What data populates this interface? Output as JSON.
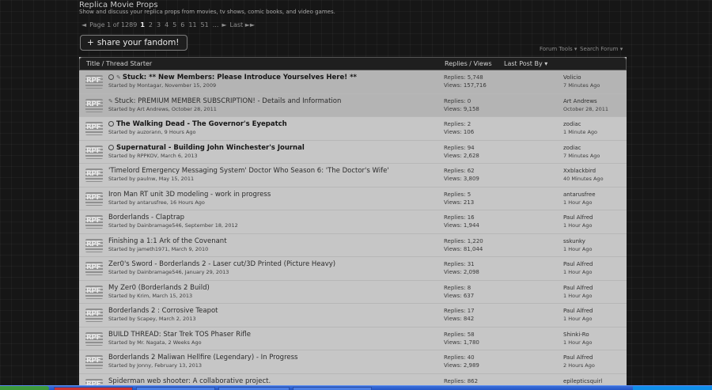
{
  "forum": {
    "title": "Replica Movie Props",
    "description": "Show and discuss your replica props from movies, tv shows, comic books, and video games."
  },
  "pagination": {
    "prev": "◄",
    "page_label": "Page 1 of 1289",
    "pages": [
      "1",
      "2",
      "3",
      "4",
      "5",
      "6",
      "11",
      "51",
      "..."
    ],
    "next": "►",
    "last": "Last ►►"
  },
  "share_button": {
    "label": "share your fandom!",
    "icon": "plus-icon"
  },
  "tools": {
    "forum_tools": "Forum Tools ▾",
    "search_forum": "Search Forum ▾"
  },
  "table": {
    "col_title": "Title / Thread Starter",
    "col_stats": "Replies / Views",
    "col_last": "Last Post By ▾",
    "rows": [
      {
        "title": "Stuck: ** New Members: Please Introduce Yourselves Here! **",
        "starter": "Started by Montagar, November 15, 2009",
        "replies": "Replies: 5,748",
        "views": "Views: 157,716",
        "last_user": "Volicio",
        "last_time": "7 Minutes Ago",
        "bold": true,
        "sticky": true,
        "circle": true,
        "pin": true
      },
      {
        "title": "Stuck: PREMIUM MEMBER SUBSCRIPTION! - Details and Information",
        "starter": "Started by Art Andrews, October 28, 2011",
        "replies": "Replies: 0",
        "views": "Views: 9,158",
        "last_user": "Art Andrews",
        "last_time": "October 28, 2011",
        "bold": false,
        "sticky": true,
        "circle": false,
        "pin": true
      },
      {
        "title": "The Walking Dead - The Governor's Eyepatch",
        "starter": "Started by auzorann, 9 Hours Ago",
        "replies": "Replies: 2",
        "views": "Views: 106",
        "last_user": "zodiac",
        "last_time": "1 Minute Ago",
        "bold": true,
        "sticky": false,
        "circle": true,
        "pin": false
      },
      {
        "title": "Supernatural - Building John Winchester's Journal",
        "starter": "Started by RPPKOV, March 6, 2013",
        "replies": "Replies: 94",
        "views": "Views: 2,628",
        "last_user": "zodiac",
        "last_time": "7 Minutes Ago",
        "bold": true,
        "sticky": false,
        "circle": true,
        "pin": false
      },
      {
        "title": "'Timelord Emergency Messaging System' Doctor Who Season 6: 'The Doctor's Wife'",
        "starter": "Started by paulnw, May 15, 2011",
        "replies": "Replies: 62",
        "views": "Views: 3,809",
        "last_user": "Xxblackbird",
        "last_time": "40 Minutes Ago",
        "bold": false,
        "sticky": false,
        "circle": false,
        "pin": false
      },
      {
        "title": "Iron Man RT unit 3D modeling - work in progress",
        "starter": "Started by antarusfree, 16 Hours Ago",
        "replies": "Replies: 5",
        "views": "Views: 213",
        "last_user": "antarusfree",
        "last_time": "1 Hour Ago",
        "bold": false,
        "sticky": false,
        "circle": false,
        "pin": false
      },
      {
        "title": "Borderlands - Claptrap",
        "starter": "Started by Dainbramage546, September 18, 2012",
        "replies": "Replies: 16",
        "views": "Views: 1,944",
        "last_user": "Paul Alfred",
        "last_time": "1 Hour Ago",
        "bold": false,
        "sticky": false,
        "circle": false,
        "pin": false
      },
      {
        "title": "Finishing a 1:1 Ark of the Covenant",
        "starter": "Started by jameth1971, March 9, 2010",
        "replies": "Replies: 1,220",
        "views": "Views: 81,044",
        "last_user": "sskunky",
        "last_time": "1 Hour Ago",
        "bold": false,
        "sticky": false,
        "circle": false,
        "pin": false
      },
      {
        "title": "Zer0's Sword - Borderlands 2 - Laser cut/3D Printed (Picture Heavy)",
        "starter": "Started by Dainbramage546, January 29, 2013",
        "replies": "Replies: 31",
        "views": "Views: 2,098",
        "last_user": "Paul Alfred",
        "last_time": "1 Hour Ago",
        "bold": false,
        "sticky": false,
        "circle": false,
        "pin": false
      },
      {
        "title": "My Zer0 (Borderlands 2 Build)",
        "starter": "Started by Krim, March 15, 2013",
        "replies": "Replies: 8",
        "views": "Views: 637",
        "last_user": "Paul Alfred",
        "last_time": "1 Hour Ago",
        "bold": false,
        "sticky": false,
        "circle": false,
        "pin": false
      },
      {
        "title": "Borderlands 2 : Corrosive Teapot",
        "starter": "Started by Scapey, March 2, 2013",
        "replies": "Replies: 17",
        "views": "Views: 842",
        "last_user": "Paul Alfred",
        "last_time": "1 Hour Ago",
        "bold": false,
        "sticky": false,
        "circle": false,
        "pin": false
      },
      {
        "title": "BUILD THREAD: Star Trek TOS Phaser Rifle",
        "starter": "Started by Mr. Nagata, 2 Weeks Ago",
        "replies": "Replies: 58",
        "views": "Views: 1,780",
        "last_user": "Shinki-Ro",
        "last_time": "1 Hour Ago",
        "bold": false,
        "sticky": false,
        "circle": false,
        "pin": false
      },
      {
        "title": "Borderlands 2 Maliwan Hellfire (Legendary) - In Progress",
        "starter": "Started by Jonny, February 13, 2013",
        "replies": "Replies: 40",
        "views": "Views: 2,989",
        "last_user": "Paul Alfred",
        "last_time": "2 Hours Ago",
        "bold": false,
        "sticky": false,
        "circle": false,
        "pin": false
      },
      {
        "title": "Spiderman web shooter: A collaborative project.",
        "starter": "",
        "replies": "Replies: 862",
        "views": "",
        "last_user": "epilepticsquirl",
        "last_time": "",
        "bold": false,
        "sticky": false,
        "circle": false,
        "pin": false
      }
    ]
  },
  "colors": {
    "page_bg": "#161616",
    "table_bg": "#c6c6c6",
    "sticky_bg": "#b4b4b4",
    "taskbar": "#2456c6"
  }
}
